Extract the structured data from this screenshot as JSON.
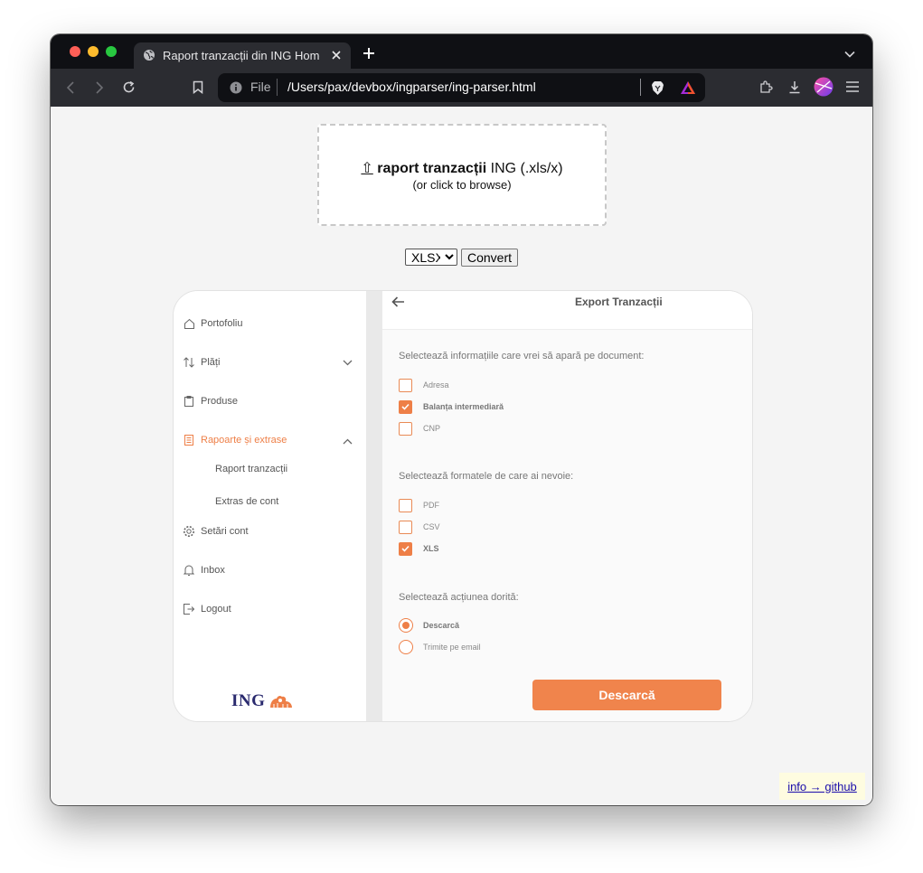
{
  "browser": {
    "tab_title": "Raport tranzacții din ING HomeBank",
    "url_scheme": "File",
    "url": "/Users/pax/devbox/ingparser/ing-parser.html"
  },
  "page": {
    "dropzone": {
      "upload_arrow": "⇧",
      "title_bold": "raport tranzacții",
      "title_rest": " ING (.xls/x)",
      "hint": "(or click to browse)"
    },
    "format_select": {
      "options": [
        "XLSX"
      ],
      "selected": "XLSX"
    },
    "convert_label": "Convert",
    "info_link": "info → github"
  },
  "ing_screenshot": {
    "sidebar": {
      "items": [
        {
          "label": "Portofoliu",
          "icon": "home-icon"
        },
        {
          "label": "Plăți",
          "icon": "transfer-arrows-icon"
        },
        {
          "label": "Produse",
          "icon": "clipboard-icon"
        },
        {
          "label": "Rapoarte și extrase",
          "icon": "document-icon",
          "active": true
        },
        {
          "label": "Setări cont",
          "icon": "gear-icon"
        },
        {
          "label": "Inbox",
          "icon": "bell-icon"
        },
        {
          "label": "Logout",
          "icon": "logout-icon"
        }
      ],
      "sub_items": [
        "Raport tranzacții",
        "Extras de cont"
      ],
      "logo_text": "ING"
    },
    "header_title": "Export Tranzacții",
    "section_info": {
      "label": "Selectează informațiile care vrei să apară pe document:",
      "options": [
        {
          "label": "Adresa",
          "checked": false
        },
        {
          "label": "Balanța intermediară",
          "checked": true
        },
        {
          "label": "CNP",
          "checked": false
        }
      ]
    },
    "section_formats": {
      "label": "Selectează formatele de care ai nevoie:",
      "options": [
        {
          "label": "PDF",
          "checked": false
        },
        {
          "label": "CSV",
          "checked": false
        },
        {
          "label": "XLS",
          "checked": true
        }
      ]
    },
    "section_action": {
      "label": "Selectează acțiunea dorită:",
      "options": [
        {
          "label": "Descarcă",
          "selected": true
        },
        {
          "label": "Trimite pe email",
          "selected": false
        }
      ]
    },
    "download_button": "Descarcă",
    "accent_color": "#ee7f47"
  }
}
